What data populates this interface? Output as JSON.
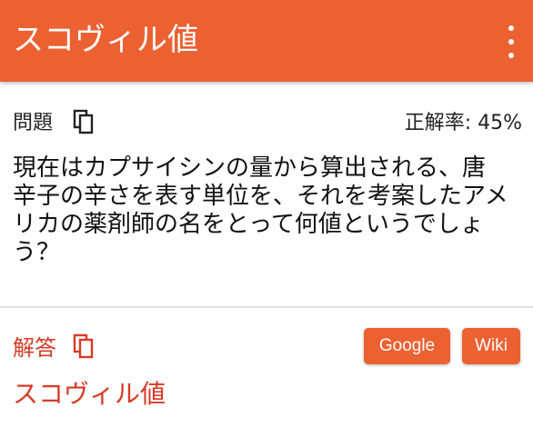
{
  "appbar": {
    "title": "スコヴィル値",
    "menu_icon": "more-vert-icon"
  },
  "question": {
    "label": "問題",
    "copy_icon": "copy-icon",
    "correct_rate": "正解率: 45%",
    "text": "現在はカプサイシンの量から算出される、唐辛子の辛さを表す単位を、それを考案したアメリカの薬剤師の名をとって何値というでしょう？"
  },
  "answer": {
    "label": "解答",
    "copy_icon": "copy-icon",
    "google_label": "Google",
    "wiki_label": "Wiki",
    "text": "スコヴィル値"
  },
  "colors": {
    "accent": "#ec6132",
    "answer_red": "#d83a26",
    "divider": "#e1e1e1"
  }
}
